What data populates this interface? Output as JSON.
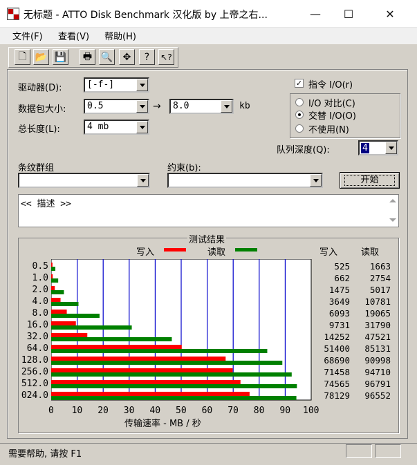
{
  "window": {
    "title": "无标题 - ATTO Disk Benchmark  汉化版 by 上帝之右...",
    "minimize": "—",
    "maximize": "☐",
    "close": "✕"
  },
  "menu": [
    "文件(F)",
    "查看(V)",
    "帮助(H)"
  ],
  "toolbar": [
    {
      "name": "new-icon",
      "glyph": "🗋"
    },
    {
      "name": "open-icon",
      "glyph": "📂"
    },
    {
      "name": "save-icon",
      "glyph": "💾"
    },
    {
      "name": "print-icon",
      "glyph": "🖶"
    },
    {
      "name": "print-preview-icon",
      "glyph": "🔍"
    },
    {
      "name": "move-icon",
      "glyph": "✥"
    },
    {
      "name": "help-icon",
      "glyph": "?"
    },
    {
      "name": "context-help-icon",
      "glyph": "↖?"
    }
  ],
  "controls": {
    "drive_label": "驱动器(D):",
    "drive_value": "[-f-]",
    "transfer_label": "数据包大小:",
    "transfer_from": "0.5",
    "transfer_arrow": "→",
    "transfer_to": "8.0",
    "transfer_unit": "kb",
    "length_label": "总长度(L):",
    "length_value": "4 mb",
    "direct_io_label": "指令 I/O(r)",
    "direct_io_checked": "✓",
    "io_compare_label": "I/O 对比(C)",
    "overlap_label": "交替 I/O(O)",
    "neither_label": "不使用(N)",
    "queue_label": "队列深度(Q):",
    "queue_value": "4",
    "stripe_label": "条纹群组",
    "constraint_label": "约束(b):",
    "start_label": "开始",
    "description": "<< 描述 >>"
  },
  "results": {
    "title": "测试结果",
    "write_legend": "写入",
    "read_legend": "读取",
    "write_header": "写入",
    "read_header": "读取",
    "write_color": "#ff0000",
    "read_color": "#008000",
    "grid_color": "#0000cc"
  },
  "chart_data": {
    "type": "bar",
    "orientation": "horizontal",
    "xlabel": "传输速率 - MB / 秒",
    "xlim": [
      0,
      100
    ],
    "xticks": [
      "0",
      "10",
      "20",
      "30",
      "40",
      "50",
      "60",
      "70",
      "80",
      "90",
      "100"
    ],
    "categories": [
      "0.5",
      "1.0",
      "2.0",
      "4.0",
      "8.0",
      "16.0",
      "32.0",
      "64.0",
      "128.0",
      "256.0",
      "512.0",
      "024.0"
    ],
    "series": [
      {
        "name": "写入",
        "values": [
          0.5,
          0.6,
          1.4,
          3.6,
          6.0,
          9.5,
          13.9,
          50.2,
          67.1,
          69.8,
          72.8,
          76.3
        ],
        "labels": [
          "525",
          "662",
          "1475",
          "3649",
          "6093",
          "9731",
          "14252",
          "51400",
          "68690",
          "71458",
          "74565",
          "78129"
        ]
      },
      {
        "name": "读取",
        "values": [
          1.6,
          2.7,
          4.9,
          10.5,
          18.6,
          31.0,
          46.4,
          83.1,
          88.9,
          92.5,
          94.5,
          94.3
        ],
        "labels": [
          "1663",
          "2754",
          "5017",
          "10781",
          "19065",
          "31790",
          "47521",
          "85131",
          "90998",
          "94710",
          "96791",
          "96552"
        ]
      }
    ]
  },
  "status": {
    "text": "需要帮助, 请按 F1"
  }
}
